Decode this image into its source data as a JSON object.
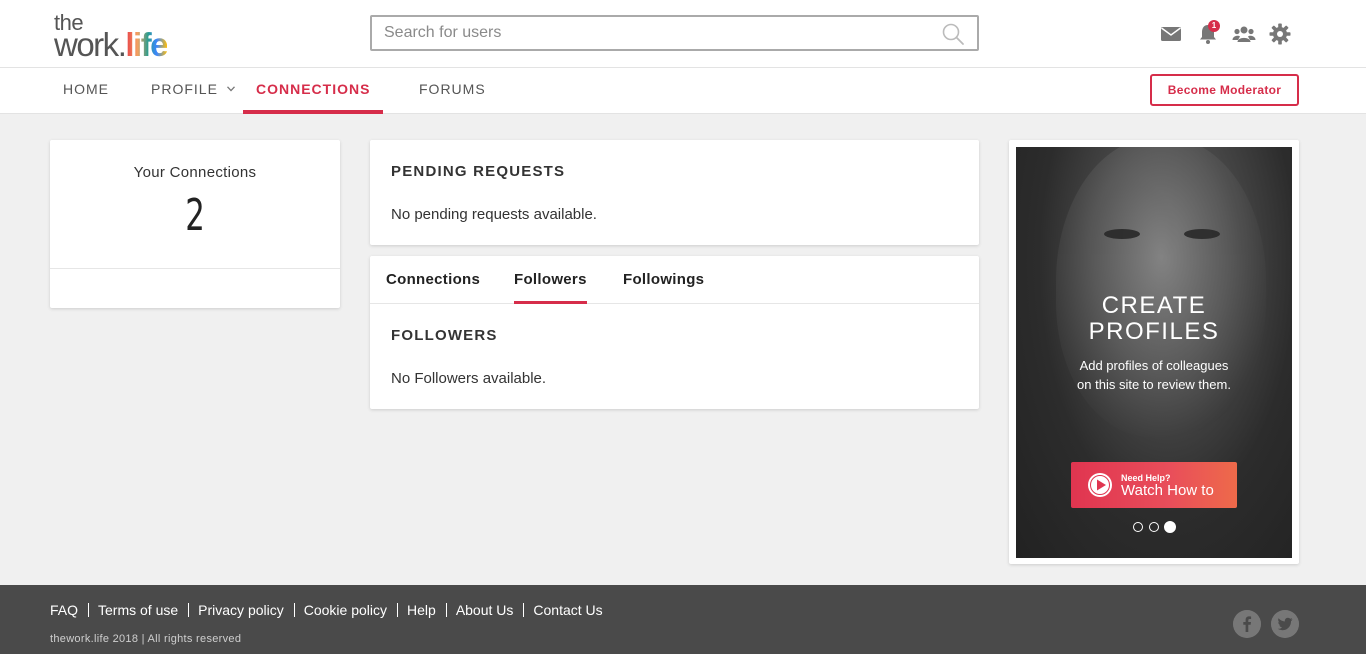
{
  "header": {
    "logo": {
      "top": "the",
      "main": "work",
      "dot": ".",
      "accent": "life"
    },
    "search": {
      "placeholder": "Search for users"
    },
    "notifications_count": "1",
    "icons": [
      "mail-icon",
      "bell-icon",
      "users-icon",
      "gear-icon"
    ]
  },
  "nav": {
    "items": [
      {
        "label": "HOME"
      },
      {
        "label": "PROFILE"
      },
      {
        "label": "CONNECTIONS"
      },
      {
        "label": "FORUMS"
      }
    ],
    "active": "CONNECTIONS",
    "moderator_button": "Become Moderator"
  },
  "connections_card": {
    "label": "Your Connections",
    "count": "2"
  },
  "pending": {
    "heading": "PENDING REQUESTS",
    "empty_text": "No pending requests available."
  },
  "tabs": {
    "items": [
      {
        "label": "Connections"
      },
      {
        "label": "Followers"
      },
      {
        "label": "Followings"
      }
    ],
    "active": "Followers",
    "section_heading": "FOLLOWERS",
    "empty_text": "No Followers available."
  },
  "promo": {
    "title_line1": "CREATE",
    "title_line2": "PROFILES",
    "subtitle_line1": "Add profiles of colleagues",
    "subtitle_line2": "on this site to review them.",
    "button_small": "Need Help?",
    "button_label": "Watch How to",
    "slides": 3,
    "active_slide": 3
  },
  "footer": {
    "links": [
      {
        "label": "FAQ"
      },
      {
        "label": "Terms of use"
      },
      {
        "label": "Privacy policy"
      },
      {
        "label": "Cookie policy"
      },
      {
        "label": "Help"
      },
      {
        "label": "About Us"
      },
      {
        "label": "Contact Us"
      }
    ],
    "copyright": "thework.life 2018 | All rights reserved"
  },
  "colors": {
    "accent": "#d62d4a",
    "footer_bg": "#4a4a4a",
    "page_bg": "#f0f0f0"
  }
}
